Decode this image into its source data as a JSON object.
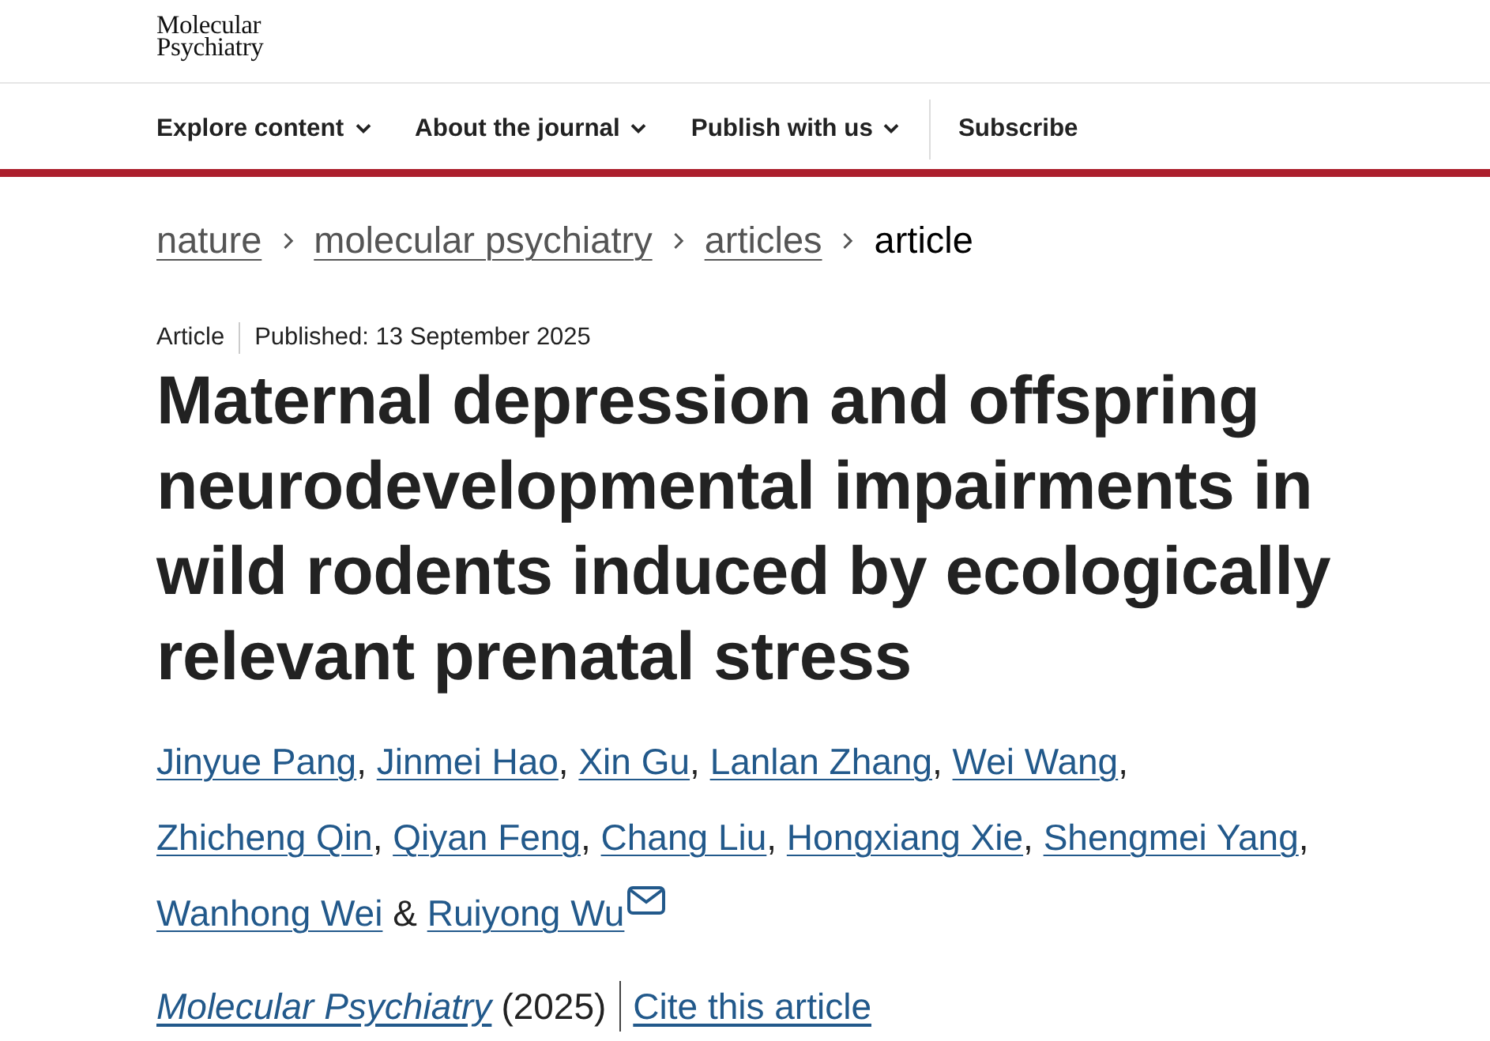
{
  "logo": [
    "Molecular",
    "Psychiatry"
  ],
  "nav": [
    {
      "label": "Explore content",
      "dropdown": true
    },
    {
      "label": "About the journal",
      "dropdown": true
    },
    {
      "label": "Publish with us",
      "dropdown": true
    },
    {
      "label": "Subscribe",
      "dropdown": false
    }
  ],
  "breadcrumb": [
    {
      "label": "nature",
      "current": false
    },
    {
      "label": "molecular psychiatry",
      "current": false
    },
    {
      "label": "articles",
      "current": false
    },
    {
      "label": "article",
      "current": true
    }
  ],
  "article": {
    "type": "Article",
    "published": "Published: 13 September 2025",
    "title": "Maternal depression and offspring neurodevelopmental impairments in wild rodents induced by ecologically relevant prenatal stress",
    "authors": [
      {
        "name": "Jinyue Pang",
        "punctuation": ","
      },
      {
        "name": "Jinmei Hao",
        "punctuation": ","
      },
      {
        "name": "Xin Gu",
        "punctuation": ","
      },
      {
        "name": "Lanlan Zhang",
        "punctuation": ","
      },
      {
        "name": "Wei Wang",
        "punctuation": ","
      },
      {
        "name": "Zhicheng Qin",
        "punctuation": ","
      },
      {
        "name": "Qiyan Feng",
        "punctuation": ","
      },
      {
        "name": "Chang Liu",
        "punctuation": ","
      },
      {
        "name": "Hongxiang Xie",
        "punctuation": ","
      },
      {
        "name": "Shengmei Yang",
        "punctuation": ","
      },
      {
        "name": "Wanhong Wei",
        "conjunction": "&"
      },
      {
        "name": "Ruiyong Wu",
        "email": true
      }
    ],
    "citation": {
      "journal": "Molecular Psychiatry",
      "year": "(2025)",
      "cite_link": "Cite this article"
    }
  }
}
